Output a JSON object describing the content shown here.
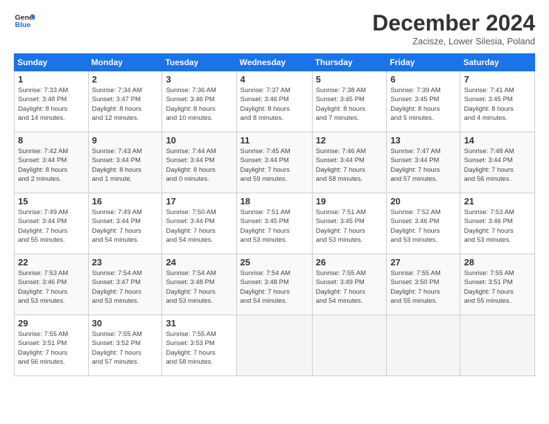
{
  "logo": {
    "line1": "General",
    "line2": "Blue"
  },
  "title": "December 2024",
  "subtitle": "Zacisze, Lower Silesia, Poland",
  "days_header": [
    "Sunday",
    "Monday",
    "Tuesday",
    "Wednesday",
    "Thursday",
    "Friday",
    "Saturday"
  ],
  "weeks": [
    [
      {
        "day": "1",
        "info": "Sunrise: 7:33 AM\nSunset: 3:48 PM\nDaylight: 8 hours\nand 14 minutes."
      },
      {
        "day": "2",
        "info": "Sunrise: 7:34 AM\nSunset: 3:47 PM\nDaylight: 8 hours\nand 12 minutes."
      },
      {
        "day": "3",
        "info": "Sunrise: 7:36 AM\nSunset: 3:46 PM\nDaylight: 8 hours\nand 10 minutes."
      },
      {
        "day": "4",
        "info": "Sunrise: 7:37 AM\nSunset: 3:46 PM\nDaylight: 8 hours\nand 8 minutes."
      },
      {
        "day": "5",
        "info": "Sunrise: 7:38 AM\nSunset: 3:45 PM\nDaylight: 8 hours\nand 7 minutes."
      },
      {
        "day": "6",
        "info": "Sunrise: 7:39 AM\nSunset: 3:45 PM\nDaylight: 8 hours\nand 5 minutes."
      },
      {
        "day": "7",
        "info": "Sunrise: 7:41 AM\nSunset: 3:45 PM\nDaylight: 8 hours\nand 4 minutes."
      }
    ],
    [
      {
        "day": "8",
        "info": "Sunrise: 7:42 AM\nSunset: 3:44 PM\nDaylight: 8 hours\nand 2 minutes."
      },
      {
        "day": "9",
        "info": "Sunrise: 7:43 AM\nSunset: 3:44 PM\nDaylight: 8 hours\nand 1 minute."
      },
      {
        "day": "10",
        "info": "Sunrise: 7:44 AM\nSunset: 3:44 PM\nDaylight: 8 hours\nand 0 minutes."
      },
      {
        "day": "11",
        "info": "Sunrise: 7:45 AM\nSunset: 3:44 PM\nDaylight: 7 hours\nand 59 minutes."
      },
      {
        "day": "12",
        "info": "Sunrise: 7:46 AM\nSunset: 3:44 PM\nDaylight: 7 hours\nand 58 minutes."
      },
      {
        "day": "13",
        "info": "Sunrise: 7:47 AM\nSunset: 3:44 PM\nDaylight: 7 hours\nand 57 minutes."
      },
      {
        "day": "14",
        "info": "Sunrise: 7:48 AM\nSunset: 3:44 PM\nDaylight: 7 hours\nand 56 minutes."
      }
    ],
    [
      {
        "day": "15",
        "info": "Sunrise: 7:49 AM\nSunset: 3:44 PM\nDaylight: 7 hours\nand 55 minutes."
      },
      {
        "day": "16",
        "info": "Sunrise: 7:49 AM\nSunset: 3:44 PM\nDaylight: 7 hours\nand 54 minutes."
      },
      {
        "day": "17",
        "info": "Sunrise: 7:50 AM\nSunset: 3:44 PM\nDaylight: 7 hours\nand 54 minutes."
      },
      {
        "day": "18",
        "info": "Sunrise: 7:51 AM\nSunset: 3:45 PM\nDaylight: 7 hours\nand 53 minutes."
      },
      {
        "day": "19",
        "info": "Sunrise: 7:51 AM\nSunset: 3:45 PM\nDaylight: 7 hours\nand 53 minutes."
      },
      {
        "day": "20",
        "info": "Sunrise: 7:52 AM\nSunset: 3:46 PM\nDaylight: 7 hours\nand 53 minutes."
      },
      {
        "day": "21",
        "info": "Sunrise: 7:53 AM\nSunset: 3:46 PM\nDaylight: 7 hours\nand 53 minutes."
      }
    ],
    [
      {
        "day": "22",
        "info": "Sunrise: 7:53 AM\nSunset: 3:46 PM\nDaylight: 7 hours\nand 53 minutes."
      },
      {
        "day": "23",
        "info": "Sunrise: 7:54 AM\nSunset: 3:47 PM\nDaylight: 7 hours\nand 53 minutes."
      },
      {
        "day": "24",
        "info": "Sunrise: 7:54 AM\nSunset: 3:48 PM\nDaylight: 7 hours\nand 53 minutes."
      },
      {
        "day": "25",
        "info": "Sunrise: 7:54 AM\nSunset: 3:48 PM\nDaylight: 7 hours\nand 54 minutes."
      },
      {
        "day": "26",
        "info": "Sunrise: 7:55 AM\nSunset: 3:49 PM\nDaylight: 7 hours\nand 54 minutes."
      },
      {
        "day": "27",
        "info": "Sunrise: 7:55 AM\nSunset: 3:50 PM\nDaylight: 7 hours\nand 55 minutes."
      },
      {
        "day": "28",
        "info": "Sunrise: 7:55 AM\nSunset: 3:51 PM\nDaylight: 7 hours\nand 55 minutes."
      }
    ],
    [
      {
        "day": "29",
        "info": "Sunrise: 7:55 AM\nSunset: 3:51 PM\nDaylight: 7 hours\nand 56 minutes."
      },
      {
        "day": "30",
        "info": "Sunrise: 7:55 AM\nSunset: 3:52 PM\nDaylight: 7 hours\nand 57 minutes."
      },
      {
        "day": "31",
        "info": "Sunrise: 7:55 AM\nSunset: 3:53 PM\nDaylight: 7 hours\nand 58 minutes."
      },
      null,
      null,
      null,
      null
    ]
  ]
}
